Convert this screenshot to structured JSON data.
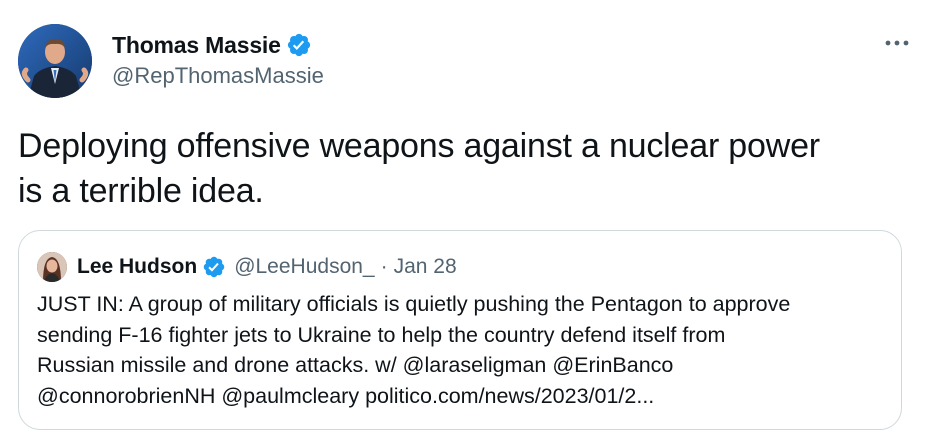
{
  "tweet": {
    "author": {
      "display_name": "Thomas Massie",
      "handle": "@RepThomasMassie",
      "verified_icon": "verified-badge-icon",
      "avatar": "avatar"
    },
    "more_icon": "more-options-icon",
    "text_lines": [
      "Deploying offensive weapons against a nuclear power",
      "is a terrible idea."
    ]
  },
  "quote": {
    "author": {
      "display_name": "Lee Hudson",
      "handle": "@LeeHudson_",
      "separator": "·",
      "date": "Jan 28"
    },
    "text_lines": [
      "JUST IN: A group of military officials is quietly pushing the Pentagon to approve",
      "sending F-16 fighter jets to Ukraine to help the country defend itself from",
      "Russian missile and drone attacks. w/ @laraseligman @ErinBanco",
      "@connorobrienNH @paulmcleary politico.com/news/2023/01/2..."
    ]
  },
  "colors": {
    "text_primary": "#0f1419",
    "text_secondary": "#536471",
    "verified_blue": "#1d9bf0",
    "border": "#cfd9de"
  }
}
